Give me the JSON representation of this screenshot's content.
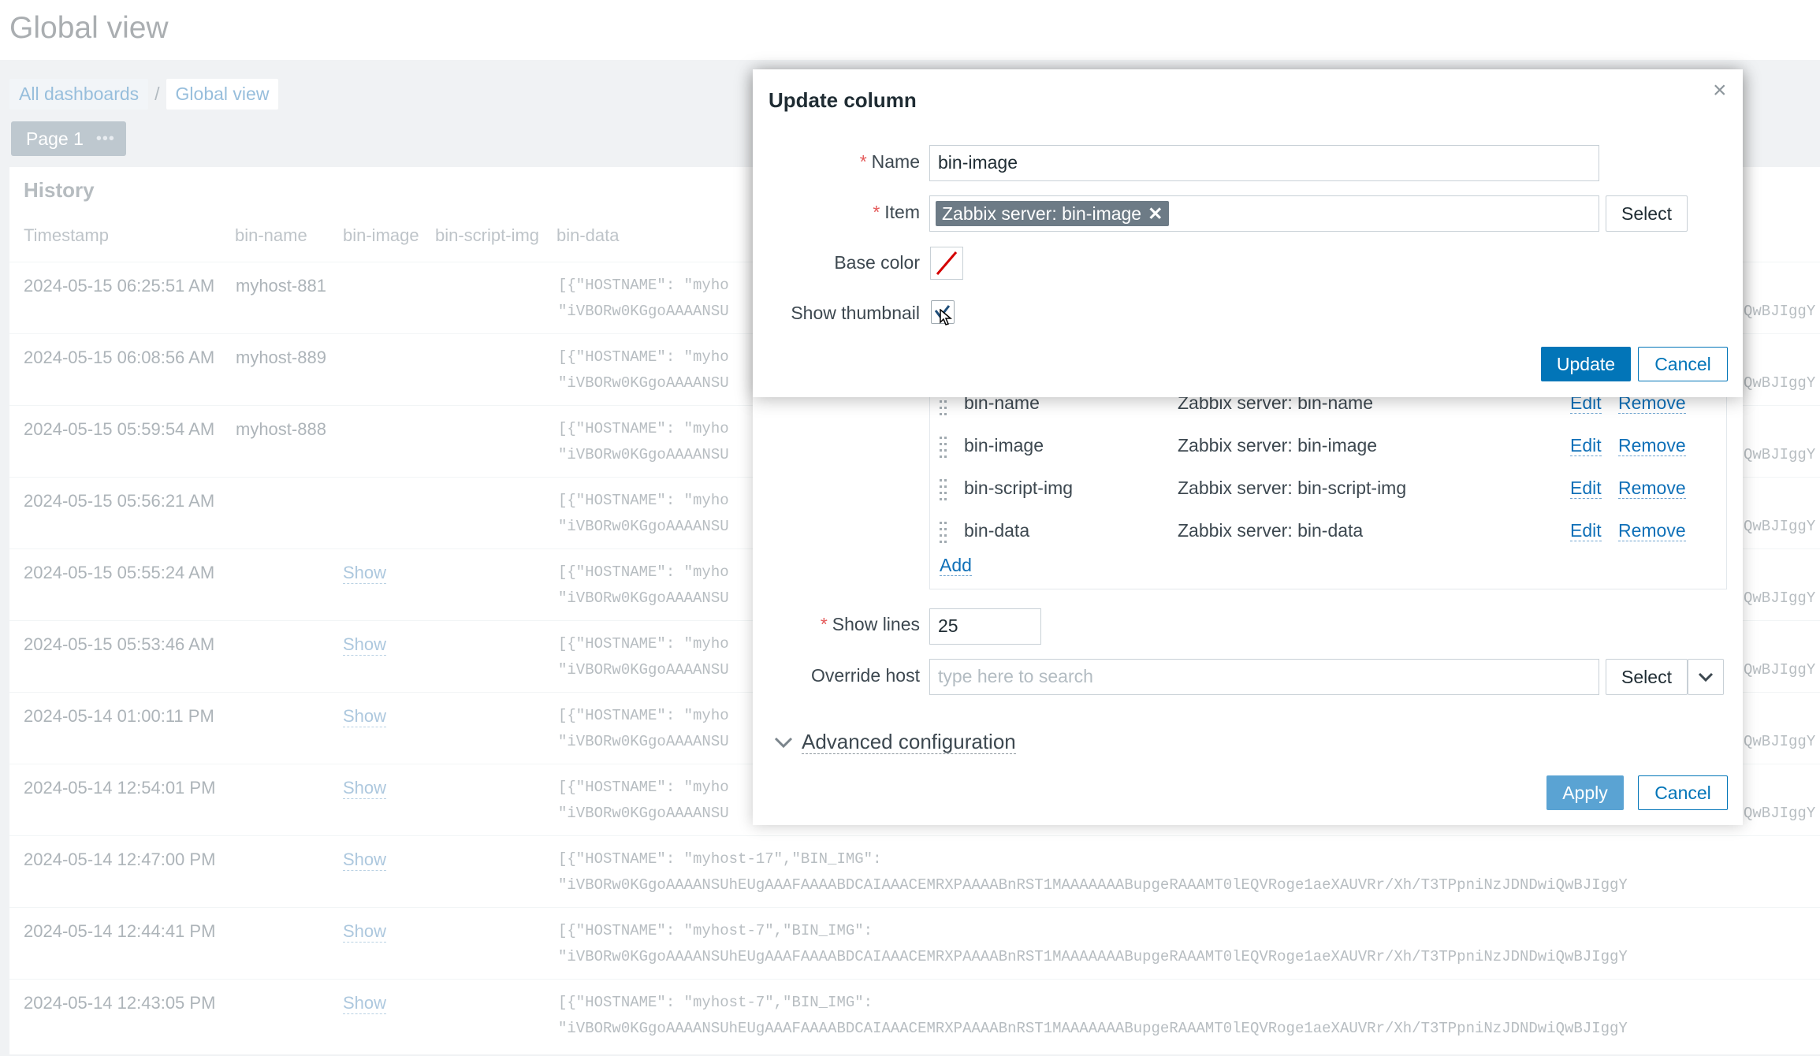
{
  "page": {
    "title": "Global view"
  },
  "breadcrumbs": [
    "All dashboards",
    "Global view"
  ],
  "breadcrumb_sep": "/",
  "page_tab": {
    "label": "Page 1",
    "menu": "•••"
  },
  "widget": {
    "title": "History",
    "columns": [
      "Timestamp",
      "bin-name",
      "bin-image",
      "bin-script-img",
      "bin-data"
    ],
    "rows": [
      {
        "ts": "2024-05-15 06:25:51 AM",
        "name": "myhost-881",
        "image": "",
        "d1": "[{\"HOSTNAME\": \"myho",
        "d2": "\"iVBORw0KGgoAAAANSU",
        "tail": "QwBJIggY"
      },
      {
        "ts": "2024-05-15 06:08:56 AM",
        "name": "myhost-889",
        "image": "",
        "d1": "[{\"HOSTNAME\": \"myho",
        "d2": "\"iVBORw0KGgoAAAANSU",
        "tail": "QwBJIggY"
      },
      {
        "ts": "2024-05-15 05:59:54 AM",
        "name": "myhost-888",
        "image": "",
        "d1": "[{\"HOSTNAME\": \"myho",
        "d2": "\"iVBORw0KGgoAAAANSU",
        "tail": "QwBJIggY"
      },
      {
        "ts": "2024-05-15 05:56:21 AM",
        "name": "",
        "image": "",
        "d1": "[{\"HOSTNAME\": \"myho",
        "d2": "\"iVBORw0KGgoAAAANSU",
        "tail": "QwBJIggY"
      },
      {
        "ts": "2024-05-15 05:55:24 AM",
        "name": "",
        "image": "Show",
        "d1": "[{\"HOSTNAME\": \"myho",
        "d2": "\"iVBORw0KGgoAAAANSU",
        "tail": "QwBJIggY"
      },
      {
        "ts": "2024-05-15 05:53:46 AM",
        "name": "",
        "image": "Show",
        "d1": "[{\"HOSTNAME\": \"myho",
        "d2": "\"iVBORw0KGgoAAAANSU",
        "tail": "QwBJIggY"
      },
      {
        "ts": "2024-05-14 01:00:11 PM",
        "name": "",
        "image": "Show",
        "d1": "[{\"HOSTNAME\": \"myho",
        "d2": "\"iVBORw0KGgoAAAANSU",
        "tail": "QwBJIggY"
      },
      {
        "ts": "2024-05-14 12:54:01 PM",
        "name": "",
        "image": "Show",
        "d1": "[{\"HOSTNAME\": \"myho",
        "d2": "\"iVBORw0KGgoAAAANSU",
        "tail": "QwBJIggY"
      },
      {
        "ts": "2024-05-14 12:47:00 PM",
        "name": "",
        "image": "Show",
        "d1": "[{\"HOSTNAME\": \"myhost-17\",\"BIN_IMG\":",
        "d2": "\"iVBORw0KGgoAAAANSUhEUgAAAFAAAABDCAIAAACEMRXPAAAABnRST1MAAAAAAABupgeRAAAMT0lEQVRoge1aeXAUVRr/Xh/T3TPpniNzJDNDwiQwBJIggY",
        "tail": ""
      },
      {
        "ts": "2024-05-14 12:44:41 PM",
        "name": "",
        "image": "Show",
        "d1": "[{\"HOSTNAME\": \"myhost-7\",\"BIN_IMG\":",
        "d2": "\"iVBORw0KGgoAAAANSUhEUgAAAFAAAABDCAIAAACEMRXPAAAABnRST1MAAAAAAABupgeRAAAMT0lEQVRoge1aeXAUVRr/Xh/T3TPpniNzJDNDwiQwBJIggY",
        "tail": ""
      },
      {
        "ts": "2024-05-14 12:43:05 PM",
        "name": "",
        "image": "Show",
        "d1": "[{\"HOSTNAME\": \"myhost-7\",\"BIN_IMG\":",
        "d2": "\"iVBORw0KGgoAAAANSUhEUgAAAFAAAABDCAIAAACEMRXPAAAABnRST1MAAAAAAABupgeRAAAMT0lEQVRoge1aeXAUVRr/Xh/T3TPpniNzJDNDwiQwBJIggY",
        "tail": ""
      }
    ]
  },
  "widget_dialog": {
    "column_list": [
      {
        "name": "bin-name",
        "item": "Zabbix server: bin-name",
        "edit": "Edit",
        "remove": "Remove"
      },
      {
        "name": "bin-image",
        "item": "Zabbix server: bin-image",
        "edit": "Edit",
        "remove": "Remove"
      },
      {
        "name": "bin-script-img",
        "item": "Zabbix server: bin-script-img",
        "edit": "Edit",
        "remove": "Remove"
      },
      {
        "name": "bin-data",
        "item": "Zabbix server: bin-data",
        "edit": "Edit",
        "remove": "Remove"
      }
    ],
    "add_label": "Add",
    "show_lines_label": "Show lines",
    "show_lines_value": "25",
    "override_host_label": "Override host",
    "override_host_placeholder": "type here to search",
    "select_label": "Select",
    "advanced_label": "Advanced configuration",
    "apply_label": "Apply",
    "cancel_label": "Cancel"
  },
  "update_dialog": {
    "title": "Update column",
    "close": "×",
    "name_label": "Name",
    "name_value": "bin-image",
    "item_label": "Item",
    "item_tag": "Zabbix server: bin-image",
    "item_tag_remove": "✕",
    "select_label": "Select",
    "base_color_label": "Base color",
    "show_thumbnail_label": "Show thumbnail",
    "show_thumbnail_checked": true,
    "update_label": "Update",
    "cancel_label": "Cancel"
  },
  "colors": {
    "accent": "#0275b8",
    "link": "#0f70b8",
    "required": "#e45959",
    "tag": "#6d7b86",
    "no_color_slash": "#d40000"
  },
  "icons": [
    "close-icon",
    "grip-icon",
    "chevron-down-icon",
    "checkmark-icon",
    "no-color-icon",
    "cursor-icon"
  ]
}
